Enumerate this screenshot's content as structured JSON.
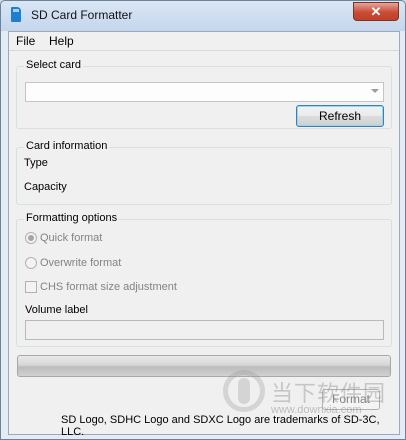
{
  "window": {
    "title": "SD Card Formatter",
    "close_glyph": "✕"
  },
  "menu": {
    "items": [
      "File",
      "Help"
    ]
  },
  "select_card": {
    "label": "Select card",
    "value": "",
    "refresh_label": "Refresh"
  },
  "card_info": {
    "label": "Card information",
    "type_label": "Type",
    "capacity_label": "Capacity"
  },
  "formatting": {
    "label": "Formatting options",
    "quick_label": "Quick format",
    "overwrite_label": "Overwrite format",
    "chs_label": "CHS format size adjustment",
    "volume_label": "Volume label",
    "volume_value": "",
    "quick_selected": true,
    "chs_checked": false
  },
  "progress": {
    "value": 0
  },
  "format_button": {
    "label": "Format"
  },
  "footer": {
    "trademark": "SD Logo, SDHC Logo and SDXC Logo are trademarks of SD-3C, LLC."
  },
  "watermark": {
    "text": "当下软件园",
    "url": "www.downxia.com"
  },
  "icons": {
    "app": "sd-card-icon",
    "close": "close-icon",
    "dropdown": "chevron-down-icon"
  }
}
